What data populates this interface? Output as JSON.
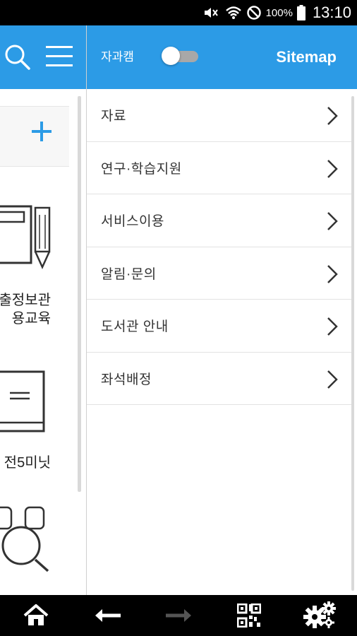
{
  "status_bar": {
    "battery_percent": "100%",
    "time": "13:10",
    "icons": [
      "mute-icon",
      "wifi-icon",
      "no-signal-icon",
      "battery-icon"
    ]
  },
  "left_page": {
    "header_icons": [
      "search-icon",
      "hamburger-menu-icon"
    ],
    "add_icon": "plus-icon",
    "tiles": [
      {
        "label_line1": "출정보관",
        "label_line2": "용교육",
        "icon": "book-pencil-icon"
      },
      {
        "label_line1": "전5미닛",
        "label_line2": "",
        "icon": "book-icon"
      },
      {
        "label_line1": "",
        "label_line2": "",
        "icon": "search-people-icon"
      }
    ]
  },
  "drawer": {
    "toggle_label": "자과캠",
    "toggle_on": false,
    "title": "Sitemap",
    "items": [
      {
        "label": "자료"
      },
      {
        "label": "연구·학습지원"
      },
      {
        "label": "서비스이용"
      },
      {
        "label": "알림·문의"
      },
      {
        "label": "도서관 안내"
      },
      {
        "label": "좌석배정"
      }
    ]
  },
  "bottom_nav": {
    "buttons": [
      "home-icon",
      "back-arrow-icon",
      "forward-arrow-icon",
      "qr-code-icon",
      "settings-gears-icon"
    ]
  },
  "colors": {
    "accent": "#2c9be6",
    "nav_bg": "#000000",
    "text": "#333333"
  }
}
